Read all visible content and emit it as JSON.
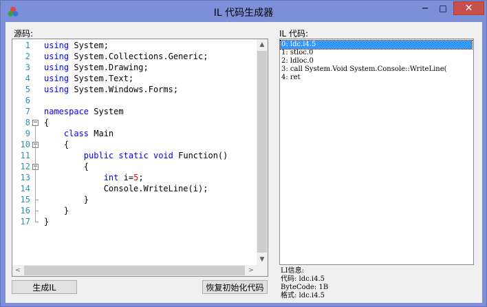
{
  "window": {
    "title": "IL 代码生成器",
    "minimize_glyph": "−",
    "maximize_glyph": "□",
    "close_glyph": "✕"
  },
  "source": {
    "label": "源码:",
    "lines": [
      {
        "n": "1",
        "parts": [
          {
            "t": "using",
            "c": "kw"
          },
          {
            "t": " System;",
            "c": "nm"
          }
        ]
      },
      {
        "n": "2",
        "parts": [
          {
            "t": "using",
            "c": "kw"
          },
          {
            "t": " System.Collections.Generic;",
            "c": "nm"
          }
        ]
      },
      {
        "n": "3",
        "parts": [
          {
            "t": "using",
            "c": "kw"
          },
          {
            "t": " System.Drawing;",
            "c": "nm"
          }
        ]
      },
      {
        "n": "4",
        "parts": [
          {
            "t": "using",
            "c": "kw"
          },
          {
            "t": " System.Text;",
            "c": "nm"
          }
        ]
      },
      {
        "n": "5",
        "parts": [
          {
            "t": "using",
            "c": "kw"
          },
          {
            "t": " System.Windows.Forms;",
            "c": "nm"
          }
        ]
      },
      {
        "n": "6",
        "parts": []
      },
      {
        "n": "7",
        "parts": [
          {
            "t": "namespace",
            "c": "kw"
          },
          {
            "t": " System",
            "c": "nm"
          }
        ]
      },
      {
        "n": "8",
        "fold": "−",
        "parts": [
          {
            "t": "{",
            "c": "nm"
          }
        ]
      },
      {
        "n": "9",
        "parts": [
          {
            "t": "    ",
            "c": "nm"
          },
          {
            "t": "class",
            "c": "kw"
          },
          {
            "t": " Main",
            "c": "nm"
          }
        ]
      },
      {
        "n": "10",
        "fold": "−",
        "parts": [
          {
            "t": "    {",
            "c": "nm"
          }
        ]
      },
      {
        "n": "11",
        "parts": [
          {
            "t": "        ",
            "c": "nm"
          },
          {
            "t": "public",
            "c": "kw"
          },
          {
            "t": " ",
            "c": "nm"
          },
          {
            "t": "static",
            "c": "kw"
          },
          {
            "t": " ",
            "c": "nm"
          },
          {
            "t": "void",
            "c": "kw"
          },
          {
            "t": " Function()",
            "c": "nm"
          }
        ]
      },
      {
        "n": "12",
        "fold": "−",
        "parts": [
          {
            "t": "        {",
            "c": "nm"
          }
        ]
      },
      {
        "n": "13",
        "parts": [
          {
            "t": "            ",
            "c": "nm"
          },
          {
            "t": "int",
            "c": "kw"
          },
          {
            "t": " i=",
            "c": "nm"
          },
          {
            "t": "5",
            "c": "num"
          },
          {
            "t": ";",
            "c": "nm"
          }
        ]
      },
      {
        "n": "14",
        "parts": [
          {
            "t": "            Console.WriteLine(i);",
            "c": "nm"
          }
        ]
      },
      {
        "n": "15",
        "parts": [
          {
            "t": "        }",
            "c": "nm"
          }
        ]
      },
      {
        "n": "16",
        "parts": [
          {
            "t": "    }",
            "c": "nm"
          }
        ]
      },
      {
        "n": "17",
        "parts": [
          {
            "t": "}",
            "c": "nm"
          }
        ]
      }
    ],
    "scroll_up": "▲",
    "scroll_down": "▼",
    "scroll_left": "<",
    "scroll_right": ">"
  },
  "il": {
    "label": "IL 代码:",
    "items": [
      "0: ldc.i4.5",
      "1: stloc.0",
      "2: ldloc.0",
      "3: call System.Void System.Console::WriteLine(",
      "4: ret"
    ],
    "selected_index": 0,
    "info": {
      "title": "LI信息:",
      "code": "代码: ldc.i4.5",
      "bytecode": "ByteCode: 1B",
      "format": "格式: ldc.i4.5"
    }
  },
  "buttons": {
    "generate": "生成IL",
    "restore": "恢复初始化代码"
  },
  "colors": {
    "titlebar": "#7c8fd8",
    "close_button": "#c7504a",
    "keyword": "#0000ff",
    "line_number": "#2b91af",
    "number_literal": "#ff0000",
    "selection": "#3399ff"
  }
}
